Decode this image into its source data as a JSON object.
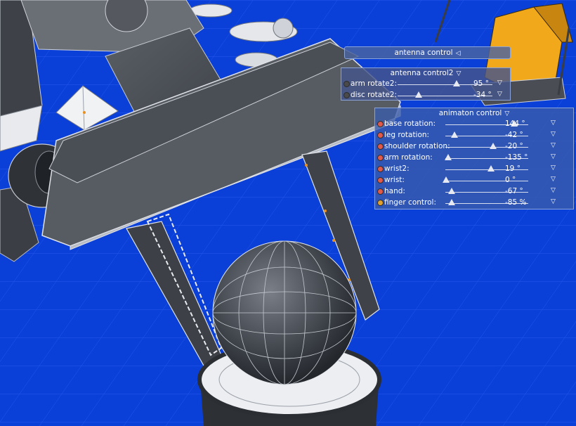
{
  "antenna_control": {
    "title": "antenna control",
    "caret_icon": "triangle-left-icon"
  },
  "antenna_control2": {
    "title": "antenna control2",
    "caret_icon": "triangle-down-icon",
    "sliders": [
      {
        "label": "arm rotate2:",
        "value": "95 °",
        "level": 0.62,
        "dot_color": "#4a4a4a"
      },
      {
        "label": "disc rotate2:",
        "value": "-34 °",
        "level": 0.22,
        "dot_color": "#4a4a4a"
      }
    ]
  },
  "animation_control": {
    "title": "animaton control",
    "caret_icon": "triangle-down-icon",
    "sliders": [
      {
        "label": "base rotation:",
        "value": "144 °",
        "level": 0.83,
        "dot_color": "#e05a4a"
      },
      {
        "label": "leg rotation:",
        "value": "-42 °",
        "level": 0.11,
        "dot_color": "#e05a4a"
      },
      {
        "label": "shoulder rotation:",
        "value": "-20 °",
        "level": 0.58,
        "dot_color": "#e05a4a"
      },
      {
        "label": "arm rotation:",
        "value": "-135 °",
        "level": 0.03,
        "dot_color": "#e05a4a"
      },
      {
        "label": "wrist2:",
        "value": "19 °",
        "level": 0.55,
        "dot_color": "#e05a4a"
      },
      {
        "label": "wrist:",
        "value": "0 °",
        "level": 0.01,
        "dot_color": "#e05a4a"
      },
      {
        "label": "hand:",
        "value": "-67 °",
        "level": 0.08,
        "dot_color": "#e05a4a"
      },
      {
        "label": "finger control:",
        "value": "-85 %",
        "level": 0.08,
        "dot_color": "#e0a030"
      }
    ]
  }
}
